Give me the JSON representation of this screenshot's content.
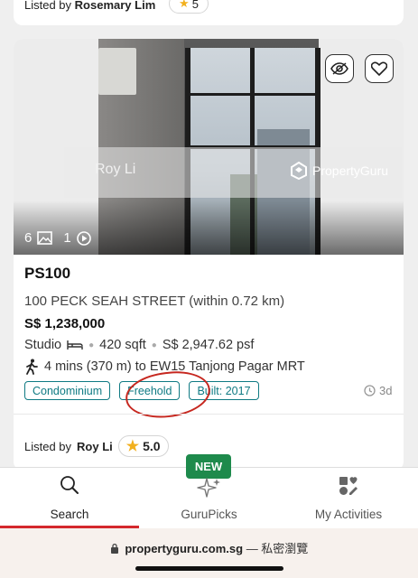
{
  "previous_listing": {
    "listed_prefix": "Listed by",
    "agent": "Rosemary Lim",
    "rating": "5"
  },
  "listing": {
    "photo": {
      "watermark_agent": "Roy Li",
      "watermark_brand": "PropertyGuru",
      "photo_count": "6",
      "video_count": "1"
    },
    "title": "PS100",
    "address": "100 PECK SEAH STREET (within 0.72 km)",
    "price": "S$ 1,238,000",
    "type": "Studio",
    "size": "420 sqft",
    "psf": "S$ 2,947.62 psf",
    "mrt": "4 mins (370 m) to EW15 Tanjong Pagar MRT",
    "tags": [
      "Condominium",
      "Freehold",
      "Built: 2017"
    ],
    "age": "3d",
    "listed_prefix": "Listed by",
    "agent": "Roy Li",
    "rating": "5.0",
    "colors": {
      "tag": "#0f7a83",
      "annotation_circle": "#c6271f",
      "star": "#f2b01e"
    }
  },
  "navbar": {
    "items": [
      {
        "label": "Search",
        "icon": "search-icon"
      },
      {
        "label": "GuruPicks",
        "icon": "sparkle-icon"
      },
      {
        "label": "My Activities",
        "icon": "activities-icon"
      }
    ],
    "new_badge": "NEW",
    "colors": {
      "accent": "#d4282d",
      "badge": "#1e8a4c"
    }
  },
  "browser": {
    "domain": "propertyguru.com.sg",
    "mode": "— 私密瀏覽"
  }
}
